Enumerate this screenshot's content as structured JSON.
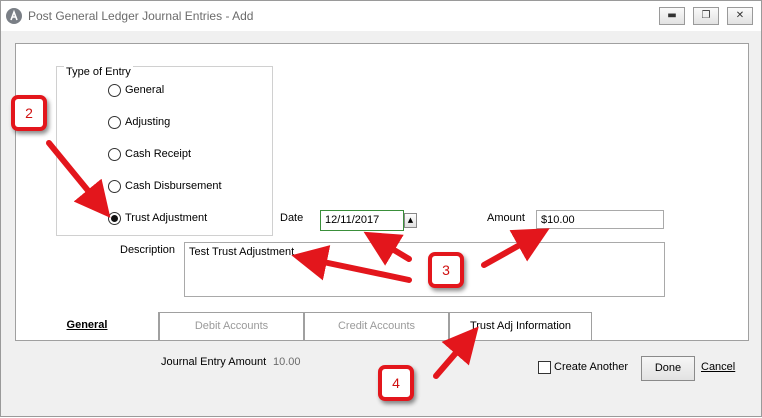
{
  "window": {
    "title": "Post General Ledger Journal Entries - Add",
    "controls": [
      "minimize-icon",
      "restore-icon",
      "close-icon"
    ]
  },
  "type_of_entry": {
    "legend": "Type of Entry",
    "options": [
      {
        "label": "General",
        "checked": false
      },
      {
        "label": "Adjusting",
        "checked": false
      },
      {
        "label": "Cash Receipt",
        "checked": false
      },
      {
        "label": "Cash Disbursement",
        "checked": false
      },
      {
        "label": "Trust Adjustment",
        "checked": true
      }
    ]
  },
  "form": {
    "date_label": "Date",
    "date_value": "12/11/2017",
    "amount_label": "Amount",
    "amount_value": "$10.00",
    "description_label": "Description",
    "description_value": "Test Trust Adjustment"
  },
  "tabs": [
    {
      "label": "General",
      "active": true
    },
    {
      "label": "Debit Accounts",
      "active": false
    },
    {
      "label": "Credit Accounts",
      "active": false
    },
    {
      "label": "Trust Adj Information",
      "active": false
    }
  ],
  "footer": {
    "journal_entry_amount_label": "Journal Entry Amount",
    "journal_entry_amount_value": "10.00",
    "create_another_label": "Create Another",
    "done_label": "Done",
    "cancel_label": "Cancel"
  },
  "callouts": [
    "2",
    "3",
    "4"
  ],
  "colors": {
    "callout_red": "#e3161c",
    "date_border": "#3a8f3a"
  }
}
